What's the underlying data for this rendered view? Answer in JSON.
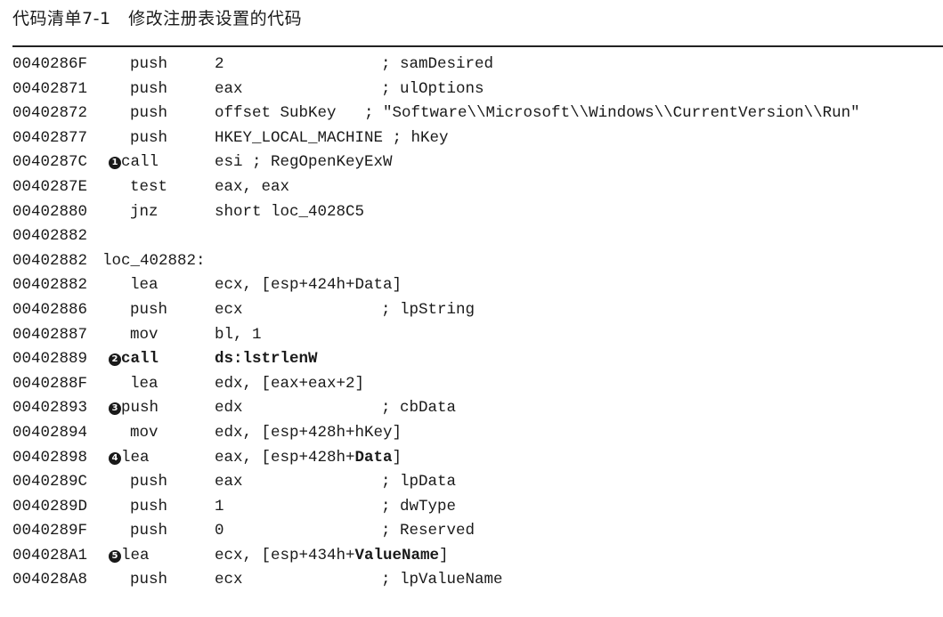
{
  "listing": {
    "title": "代码清单7-1   修改注册表设置的代码"
  },
  "code": {
    "lines": [
      {
        "addr": "0040286F",
        "marker": "",
        "mnem": "push",
        "ops_a": "2",
        "ops_b": "",
        "ops_c": "",
        "comment": "; samDesired"
      },
      {
        "addr": "00402871",
        "marker": "",
        "mnem": "push",
        "ops_a": "eax",
        "ops_b": "",
        "ops_c": "",
        "comment": "; ulOptions"
      },
      {
        "addr": "00402872",
        "marker": "",
        "mnem": "push",
        "ops_a": "offset SubKey   ; \"Software\\\\Microsoft\\\\Windows\\\\CurrentVersion\\\\Run\"",
        "ops_b": "",
        "ops_c": "",
        "comment": ""
      },
      {
        "addr": "00402877",
        "marker": "",
        "mnem": "push",
        "ops_a": "HKEY_LOCAL_MACHINE ; hKey",
        "ops_b": "",
        "ops_c": "",
        "comment": ""
      },
      {
        "addr": "0040287C",
        "marker": "1",
        "mnem": "call",
        "ops_a": "esi ; RegOpenKeyExW",
        "ops_b": "",
        "ops_c": "",
        "comment": ""
      },
      {
        "addr": "0040287E",
        "marker": "",
        "mnem": "test",
        "ops_a": "eax, eax",
        "ops_b": "",
        "ops_c": "",
        "comment": ""
      },
      {
        "addr": "00402880",
        "marker": "",
        "mnem": "jnz",
        "ops_a": "short loc_4028C5",
        "ops_b": "",
        "ops_c": "",
        "comment": ""
      },
      {
        "addr": "00402882",
        "marker": "",
        "mnem": "",
        "ops_a": "",
        "ops_b": "",
        "ops_c": "",
        "comment": ""
      },
      {
        "addr": "00402882",
        "label": "loc_402882:"
      },
      {
        "addr": "00402882",
        "marker": "",
        "mnem": "lea",
        "ops_a": "ecx, [esp+424h+Data]",
        "ops_b": "",
        "ops_c": "",
        "comment": ""
      },
      {
        "addr": "00402886",
        "marker": "",
        "mnem": "push",
        "ops_a": "ecx",
        "ops_b": "",
        "ops_c": "",
        "comment": "; lpString"
      },
      {
        "addr": "00402887",
        "marker": "",
        "mnem": "mov",
        "ops_a": "bl, 1",
        "ops_b": "",
        "ops_c": "",
        "comment": ""
      },
      {
        "addr": "00402889",
        "marker": "2",
        "mnem": "call",
        "ops_a": "",
        "ops_b": "ds:lstrlenW",
        "ops_c": "",
        "comment": "",
        "bold_mnem": true
      },
      {
        "addr": "0040288F",
        "marker": "",
        "mnem": "lea",
        "ops_a": "edx, [eax+eax+2]",
        "ops_b": "",
        "ops_c": "",
        "comment": ""
      },
      {
        "addr": "00402893",
        "marker": "3",
        "mnem": "push",
        "ops_a": "edx",
        "ops_b": "",
        "ops_c": "",
        "comment": "; cbData"
      },
      {
        "addr": "00402894",
        "marker": "",
        "mnem": "mov",
        "ops_a": "edx, [esp+428h+hKey]",
        "ops_b": "",
        "ops_c": "",
        "comment": ""
      },
      {
        "addr": "00402898",
        "marker": "4",
        "mnem": "lea",
        "ops_a": "eax, [esp+428h+",
        "ops_b": "Data",
        "ops_c": "]",
        "comment": ""
      },
      {
        "addr": "0040289C",
        "marker": "",
        "mnem": "push",
        "ops_a": "eax",
        "ops_b": "",
        "ops_c": "",
        "comment": "; lpData"
      },
      {
        "addr": "0040289D",
        "marker": "",
        "mnem": "push",
        "ops_a": "1",
        "ops_b": "",
        "ops_c": "",
        "comment": "; dwType"
      },
      {
        "addr": "0040289F",
        "marker": "",
        "mnem": "push",
        "ops_a": "0",
        "ops_b": "",
        "ops_c": "",
        "comment": "; Reserved"
      },
      {
        "addr": "004028A1",
        "marker": "5",
        "mnem": "lea",
        "ops_a": "ecx, [esp+434h+",
        "ops_b": "ValueName",
        "ops_c": "]",
        "comment": ""
      },
      {
        "addr": "004028A8",
        "marker": "",
        "mnem": "push",
        "ops_a": "ecx",
        "ops_b": "",
        "ops_c": "",
        "comment": "; lpValueName"
      }
    ]
  }
}
